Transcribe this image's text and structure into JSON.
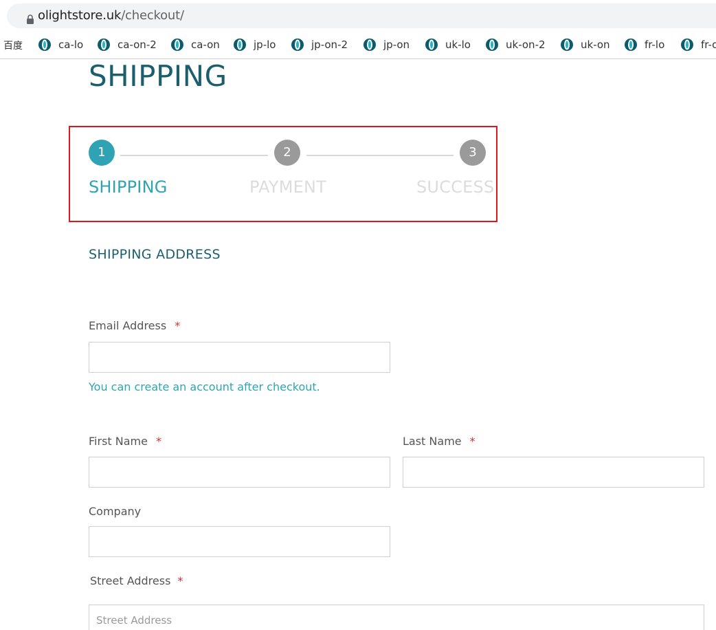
{
  "browser": {
    "url_host": "olightstore.uk",
    "url_path": "/checkout/"
  },
  "bookmarks": {
    "baidu": "百度",
    "items": [
      "ca-lo",
      "ca-on-2",
      "ca-on",
      "jp-lo",
      "jp-on-2",
      "jp-on",
      "uk-lo",
      "uk-on-2",
      "uk-on",
      "fr-lo",
      "fr-o"
    ]
  },
  "page": {
    "title": "SHIPPING"
  },
  "steps": [
    {
      "number": "1",
      "label": "SHIPPING",
      "state": "active",
      "color": "#2fa3b4"
    },
    {
      "number": "2",
      "label": "PAYMENT",
      "state": "inactive",
      "color": "#9a9a9a"
    },
    {
      "number": "3",
      "label": "SUCCESS",
      "state": "inactive",
      "color": "#9a9a9a"
    }
  ],
  "section": {
    "title": "SHIPPING ADDRESS"
  },
  "form": {
    "email_label": "Email Address",
    "email_hint": "You can create an account after checkout.",
    "first_name_label": "First Name",
    "last_name_label": "Last Name",
    "company_label": "Company",
    "street_label": "Street Address",
    "street_placeholder": "Street Address",
    "required_mark": "*"
  },
  "colors": {
    "accent": "#2fa3b4",
    "title": "#1b5f6e",
    "required": "#d0312d",
    "highlight_border": "#e0161b"
  }
}
